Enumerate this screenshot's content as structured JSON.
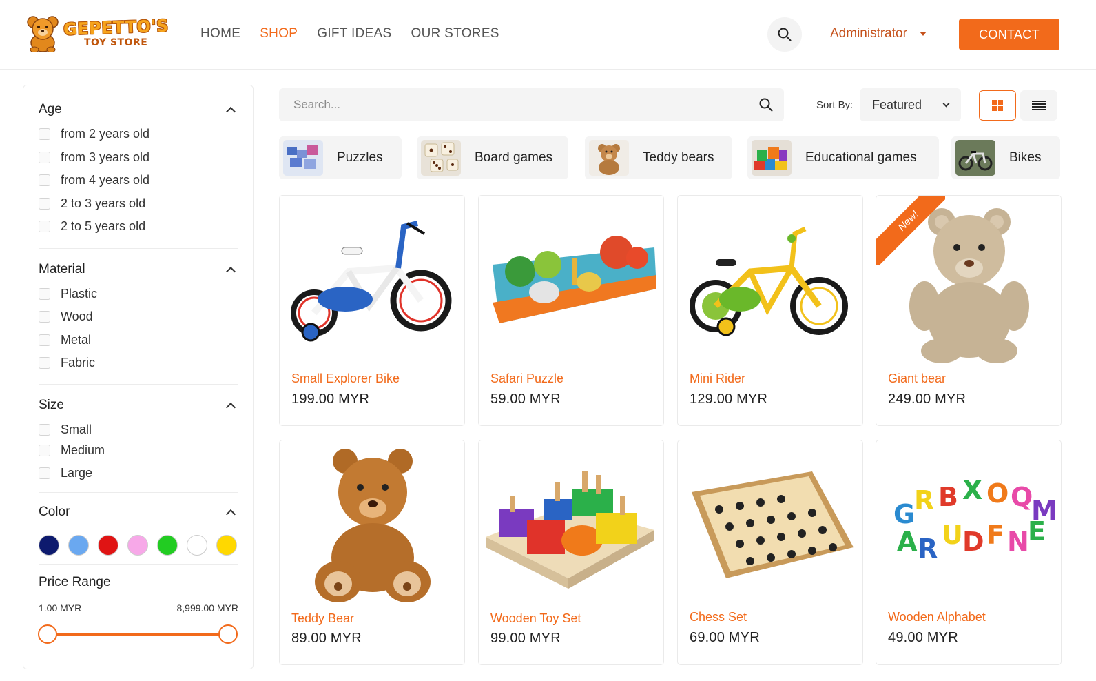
{
  "header": {
    "logo": {
      "title": "GEPETTO'S",
      "subtitle": "TOY STORE"
    },
    "nav": [
      {
        "label": "HOME",
        "active": false
      },
      {
        "label": "SHOP",
        "active": true
      },
      {
        "label": "GIFT IDEAS",
        "active": false
      },
      {
        "label": "OUR STORES",
        "active": false
      }
    ],
    "user": "Administrator",
    "contact_label": "CONTACT"
  },
  "filters": {
    "age": {
      "title": "Age",
      "options": [
        "from 2 years old",
        "from 3 years old",
        "from 4 years old",
        "2 to 3 years old",
        "2 to 5 years old"
      ]
    },
    "material": {
      "title": "Material",
      "options": [
        "Plastic",
        "Wood",
        "Metal",
        "Fabric"
      ]
    },
    "size": {
      "title": "Size",
      "options": [
        "Small",
        "Medium",
        "Large"
      ]
    },
    "color": {
      "title": "Color",
      "swatches": [
        "#0d1a6e",
        "#6aa8f0",
        "#e01414",
        "#f7a8e8",
        "#22cc22",
        "#ffffff",
        "#ffd800"
      ]
    },
    "price": {
      "title": "Price Range",
      "min": "1.00 MYR",
      "max": "8,999.00 MYR"
    }
  },
  "toolbar": {
    "search_placeholder": "Search...",
    "sort_label": "Sort By:",
    "sort_value": "Featured"
  },
  "categories": [
    {
      "label": "Puzzles",
      "icon": "puzzle-thumb"
    },
    {
      "label": "Board games",
      "icon": "dice-thumb"
    },
    {
      "label": "Teddy bears",
      "icon": "teddy-thumb"
    },
    {
      "label": "Educational games",
      "icon": "blocks-thumb"
    },
    {
      "label": "Bikes",
      "icon": "bike-thumb"
    }
  ],
  "products": [
    {
      "name": "Small Explorer Bike",
      "price": "199.00 MYR"
    },
    {
      "name": "Safari Puzzle",
      "price": "59.00 MYR"
    },
    {
      "name": "Mini Rider",
      "price": "129.00 MYR"
    },
    {
      "name": "Giant bear",
      "price": "249.00 MYR",
      "badge": "New!"
    },
    {
      "name": "Teddy Bear",
      "price": "89.00 MYR"
    },
    {
      "name": "Wooden Toy Set",
      "price": "99.00 MYR"
    },
    {
      "name": "Chess Set",
      "price": "69.00 MYR"
    },
    {
      "name": "Wooden Alphabet",
      "price": "49.00 MYR"
    }
  ],
  "colors": {
    "accent": "#f26a1b",
    "brand_dark": "#c5511b"
  }
}
